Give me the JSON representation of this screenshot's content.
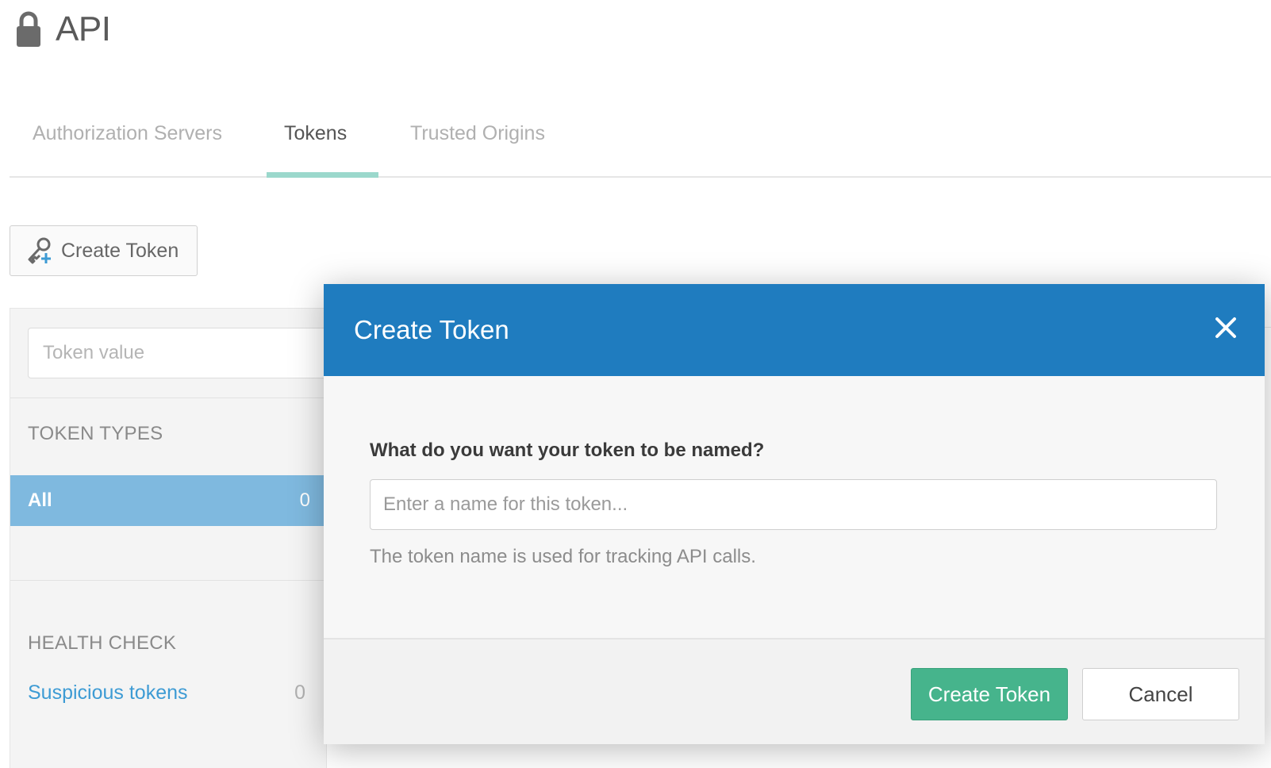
{
  "header": {
    "title": "API",
    "icon": "lock-icon"
  },
  "tabs": [
    {
      "label": "Authorization Servers",
      "active": false
    },
    {
      "label": "Tokens",
      "active": true
    },
    {
      "label": "Trusted Origins",
      "active": false
    }
  ],
  "toolbar": {
    "create_label": "Create Token",
    "create_icon": "key-add-icon"
  },
  "sidebar": {
    "search_placeholder": "Token value",
    "token_types_heading": "TOKEN TYPES",
    "token_types": [
      {
        "label": "All",
        "count": "0",
        "selected": true
      }
    ],
    "health_check_heading": "HEALTH CHECK",
    "health_items": [
      {
        "label": "Suspicious tokens",
        "count": "0"
      }
    ]
  },
  "modal": {
    "title": "Create Token",
    "field_label": "What do you want your token to be named?",
    "input_placeholder": "Enter a name for this token...",
    "input_value": "",
    "help_text": "The token name is used for tracking API calls.",
    "primary_button": "Create Token",
    "secondary_button": "Cancel"
  },
  "colors": {
    "modal_header": "#1f7cbf",
    "primary_button": "#46b48c",
    "selected_row": "#7fb9df",
    "tab_underline": "#9bd8cc",
    "link": "#3d9bd4"
  }
}
